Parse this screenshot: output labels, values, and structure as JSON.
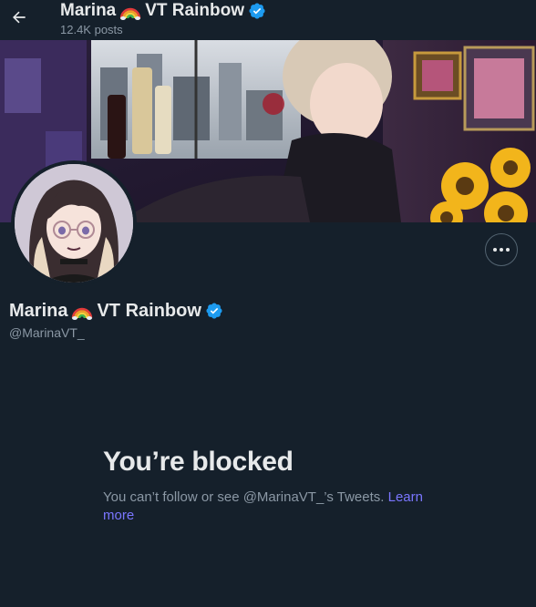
{
  "header": {
    "display_name": "Marina",
    "display_name_suffix": "VT Rainbow",
    "posts_count": "12.4K posts"
  },
  "profile": {
    "display_name": "Marina",
    "display_name_suffix": "VT Rainbow",
    "handle": "@MarinaVT_",
    "verified": true
  },
  "icons": {
    "back": "arrow-left-icon",
    "verified": "verified-badge-icon",
    "more": "more-horizontal-icon",
    "rainbow": "rainbow-emoji-icon"
  },
  "blocked": {
    "title": "You’re blocked",
    "message_prefix": "You can’t follow or see @MarinaVT_’s Tweets. ",
    "link_label": "Learn more"
  },
  "colors": {
    "background": "#15202b",
    "text_primary": "#e7e9ea",
    "text_secondary": "#8b98a5",
    "verified_blue": "#1d9bf0",
    "link": "#7a76ff"
  }
}
